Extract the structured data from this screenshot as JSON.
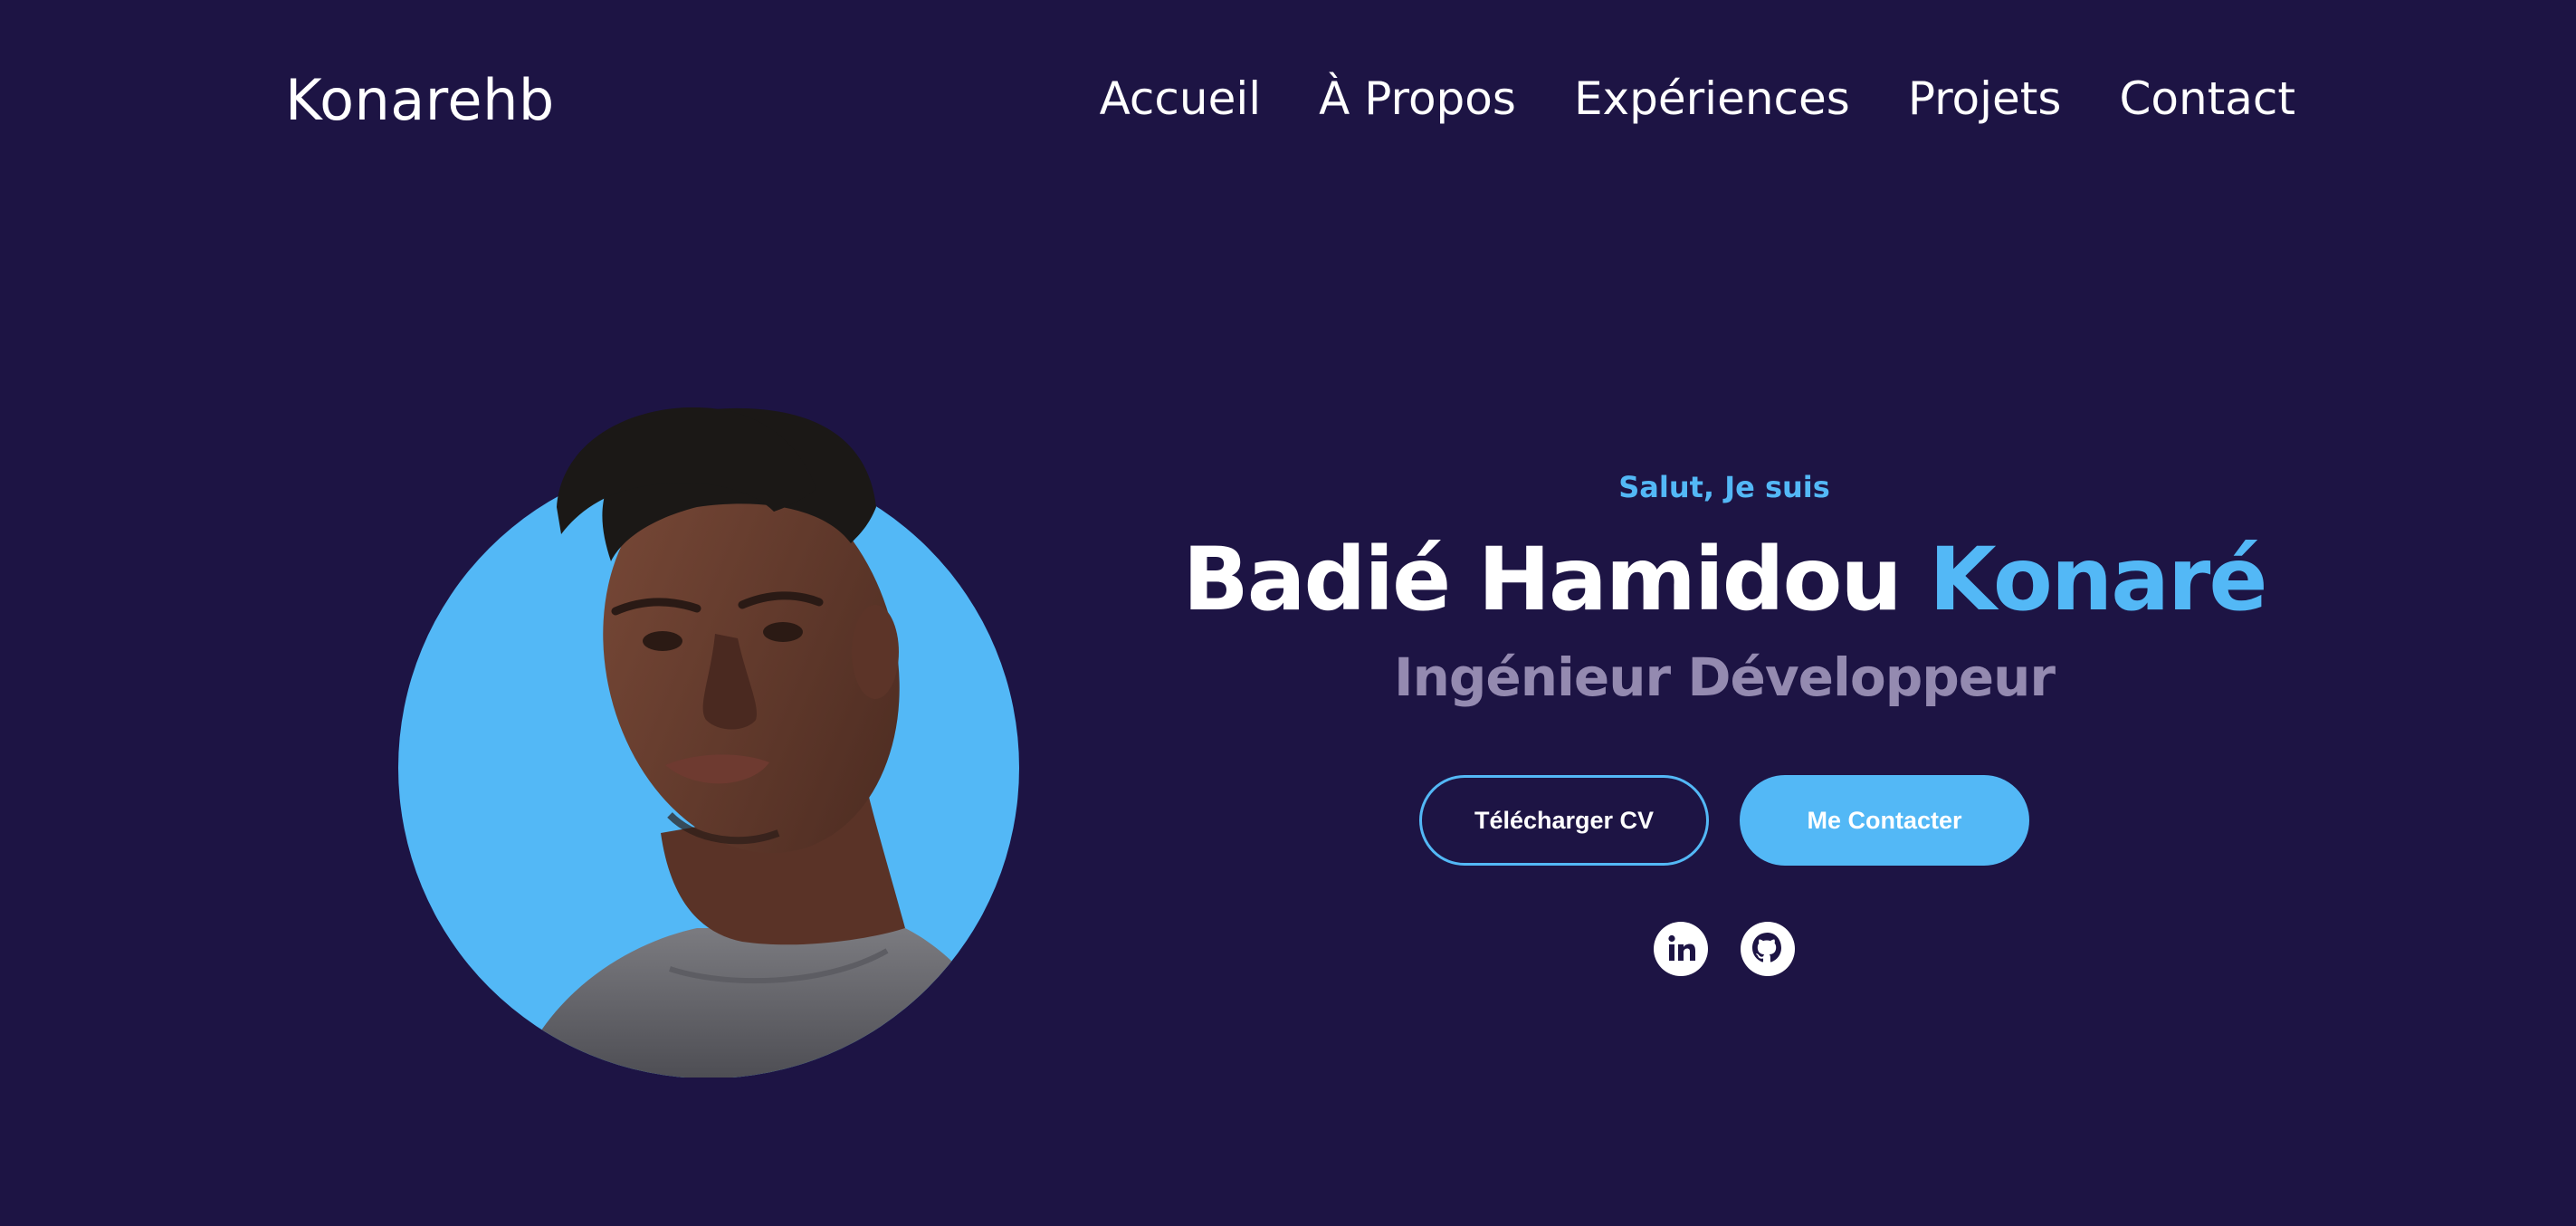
{
  "header": {
    "logo": "Konarehb",
    "nav": [
      "Accueil",
      "À Propos",
      "Expériences",
      "Projets",
      "Contact"
    ]
  },
  "hero": {
    "greeting": "Salut, Je suis",
    "name_main": "Badié Hamidou",
    "name_accent": "Konaré",
    "role": "Ingénieur Développeur",
    "download_cv_label": "Télécharger CV",
    "contact_label": "Me Contacter",
    "portrait_icon": "profile-photo",
    "socials": [
      "linkedin-icon",
      "github-icon"
    ]
  },
  "colors": {
    "background": "#1d1444",
    "accent": "#53b8f6",
    "muted": "#948ab0",
    "text": "#ffffff"
  }
}
